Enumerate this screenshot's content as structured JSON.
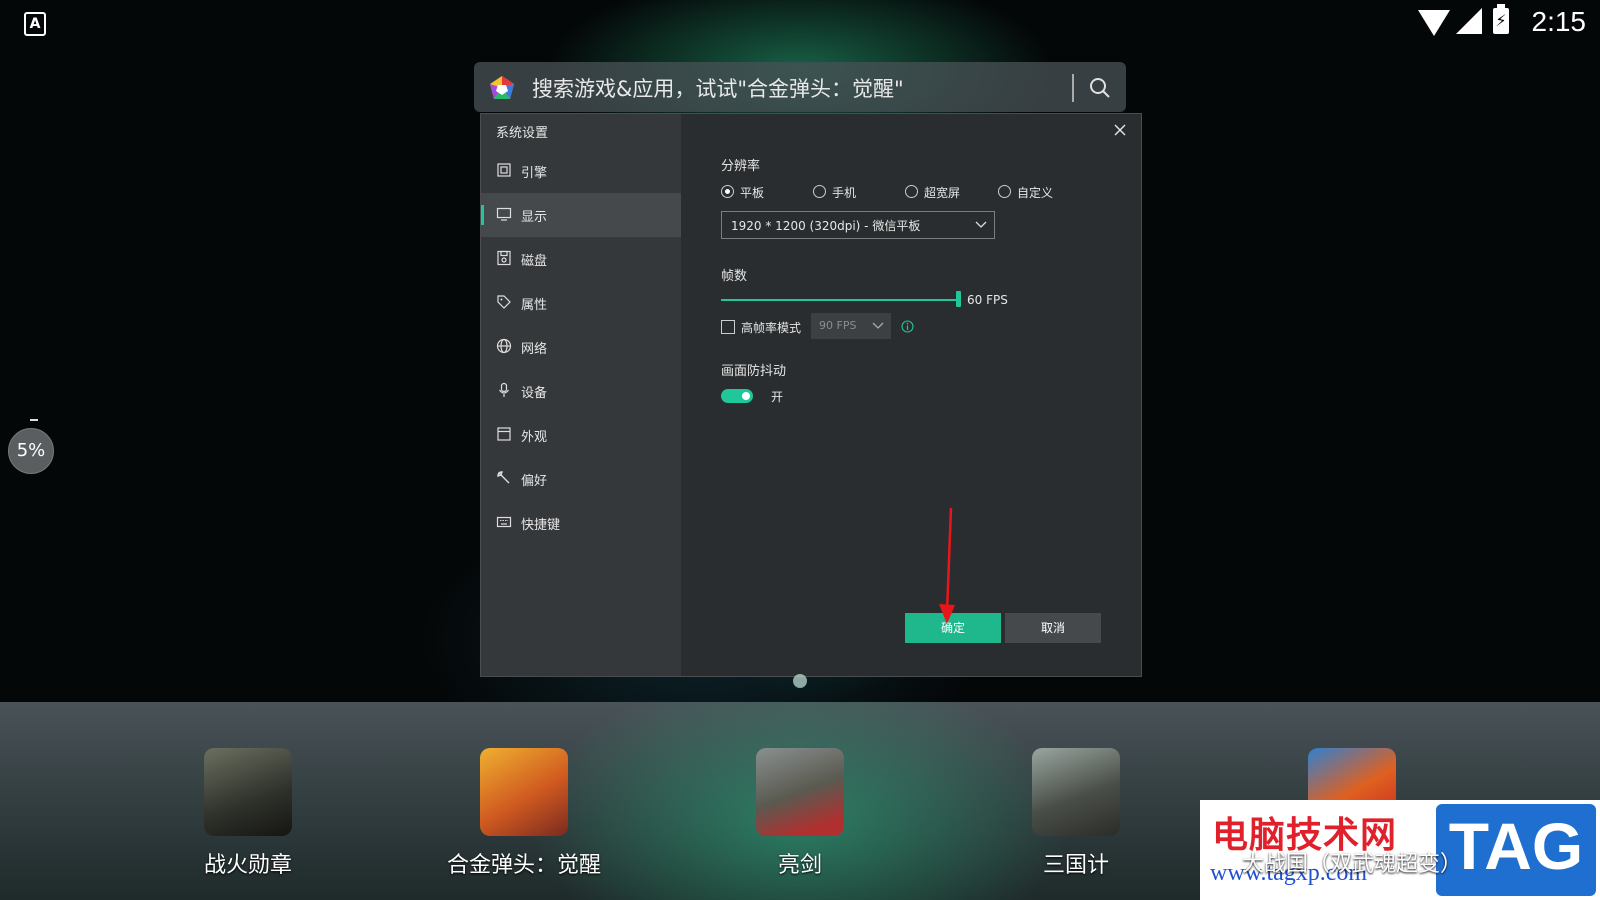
{
  "statusbar": {
    "time": "2:15",
    "app_indicator": "A",
    "battery_glyph": "⚡"
  },
  "search": {
    "placeholder": "搜索游戏&应用，试试\"合金弹头：觉醒\""
  },
  "progress": {
    "value": "5%"
  },
  "dialog": {
    "title": "系统设置",
    "nav": [
      {
        "label": "引擎",
        "icon": "engine-icon"
      },
      {
        "label": "显示",
        "icon": "monitor-icon",
        "active": true
      },
      {
        "label": "磁盘",
        "icon": "disk-icon"
      },
      {
        "label": "属性",
        "icon": "tag-icon"
      },
      {
        "label": "网络",
        "icon": "globe-icon"
      },
      {
        "label": "设备",
        "icon": "microphone-icon"
      },
      {
        "label": "外观",
        "icon": "window-icon"
      },
      {
        "label": "偏好",
        "icon": "wrench-icon"
      },
      {
        "label": "快捷键",
        "icon": "keyboard-icon"
      }
    ],
    "resolution": {
      "title": "分辨率",
      "options": [
        "平板",
        "手机",
        "超宽屏",
        "自定义"
      ],
      "selected": "平板",
      "value": "1920 * 1200 (320dpi) - 微信平板"
    },
    "framerate": {
      "title": "帧数",
      "value_label": "60 FPS",
      "slider_fraction": 1.0,
      "high_mode_label": "高帧率模式",
      "high_mode_checked": false,
      "high_mode_value": "90 FPS"
    },
    "stabilize": {
      "title": "画面防抖动",
      "toggle_label": "开",
      "on": true
    },
    "buttons": {
      "ok": "确定",
      "cancel": "取消"
    }
  },
  "dock": {
    "apps": [
      {
        "label": "战火勋章"
      },
      {
        "label": "合金弹头：觉醒"
      },
      {
        "label": "亮剑"
      },
      {
        "label": "三国计"
      },
      {
        "label": "大战国（双武魂超变）"
      }
    ]
  },
  "watermark": {
    "title": "电脑技术网",
    "url": "www.tagxp.com",
    "tag": "TAG"
  },
  "colors": {
    "accent": "#1fc79a",
    "ok_button": "#1fb88c",
    "dialog_bg": "#2a2d2f",
    "nav_bg": "#35383b"
  }
}
